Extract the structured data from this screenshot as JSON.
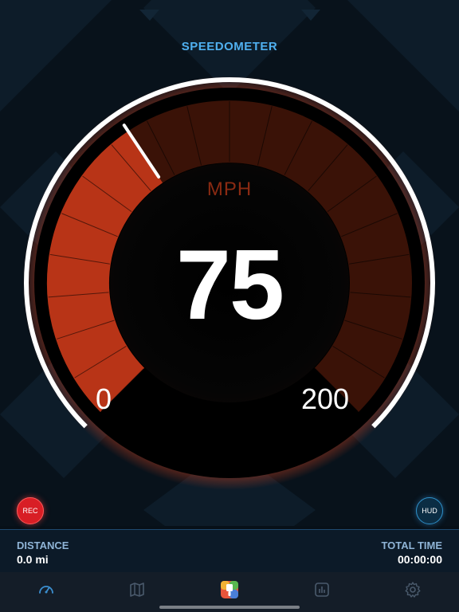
{
  "header": {
    "title": "SPEEDOMETER"
  },
  "gauge": {
    "unit": "MPH",
    "speed": "75",
    "min_label": "0",
    "max_label": "200",
    "speed_value": 75,
    "min_value": 0,
    "max_value": 200,
    "accent_color": "#e0431b",
    "ring_color": "#ffffff"
  },
  "buttons": {
    "rec_label": "REC",
    "hud_label": "HUD"
  },
  "stats": {
    "distance_label": "DISTANCE",
    "distance_value": "0.0 mi",
    "time_label": "TOTAL TIME",
    "time_value": "00:00:00"
  },
  "tabbar": {
    "tabs": [
      {
        "icon": "speedometer-icon",
        "active": true
      },
      {
        "icon": "map-icon",
        "active": false
      },
      {
        "icon": "theme-brush-icon",
        "active": false
      },
      {
        "icon": "stats-chart-icon",
        "active": false
      },
      {
        "icon": "gear-icon",
        "active": false
      }
    ],
    "active_color": "#3b8fd0",
    "inactive_color": "#4a5a6c"
  }
}
